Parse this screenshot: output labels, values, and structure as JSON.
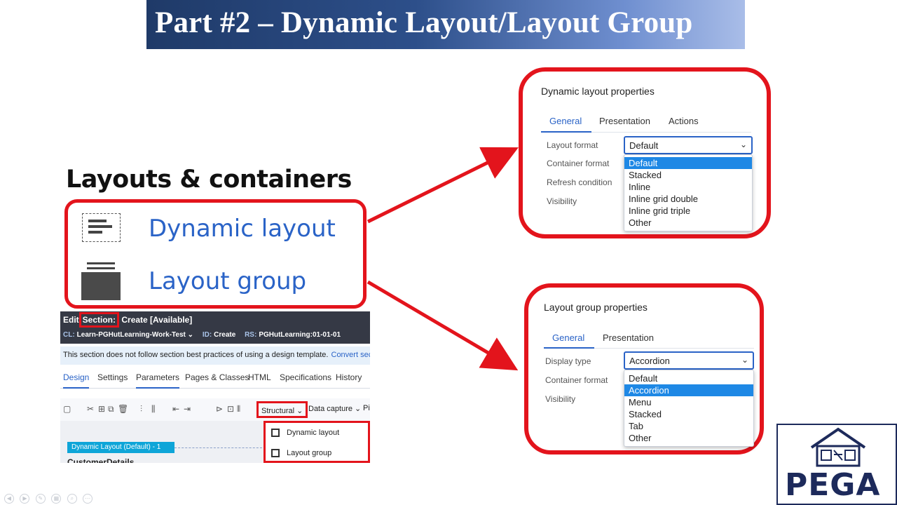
{
  "title": "Part #2 – Dynamic Layout/Layout Group",
  "layouts": {
    "heading": "Layouts & containers",
    "items": [
      {
        "label": "Dynamic layout",
        "icon": "dynamic-layout-icon"
      },
      {
        "label": "Layout group",
        "icon": "layout-group-icon"
      }
    ]
  },
  "editor": {
    "title_prefix": "Edit",
    "section_label": "Section:",
    "title_rest": "Create [Available]",
    "meta": {
      "cl_key": "CL:",
      "cl_value": "Learn-PGHutLearning-Work-Test ⌄",
      "id_key": "ID:",
      "id_value": "Create",
      "rs_key": "RS:",
      "rs_value": "PGHutLearning:01-01-01"
    },
    "notice": "This section does not follow section best practices of using a design template.",
    "notice_link": "Convert section to use",
    "tabs": [
      "Design",
      "Settings",
      "Parameters",
      "Pages & Classes",
      "HTML",
      "Specifications",
      "History"
    ],
    "toolbar": {
      "structural_label": "Structural ⌄",
      "data_capture_label": "Data capture ⌄",
      "more_label": "Pi"
    },
    "canvas": {
      "chip_label": "Dynamic Layout (Default) -   1",
      "section_label": "CustomerDetails"
    },
    "structural_menu": [
      "Dynamic layout",
      "Layout group"
    ]
  },
  "dynamic_panel": {
    "title": "Dynamic layout properties",
    "tabs": [
      "General",
      "Presentation",
      "Actions"
    ],
    "active_tab": "General",
    "fields": [
      "Layout format",
      "Container format",
      "Refresh condition",
      "Visibility"
    ],
    "select_value": "Default",
    "options": [
      "Default",
      "Stacked",
      "Inline",
      "Inline grid double",
      "Inline grid triple",
      "Other"
    ],
    "selected_option": "Default"
  },
  "group_panel": {
    "title": "Layout group properties",
    "tabs": [
      "General",
      "Presentation"
    ],
    "active_tab": "General",
    "fields": [
      "Display type",
      "Container format",
      "Visibility"
    ],
    "select_value": "Accordion",
    "options": [
      "Default",
      "Accordion",
      "Menu",
      "Stacked",
      "Tab",
      "Other"
    ],
    "selected_option": "Accordion"
  },
  "logo": {
    "text": "PEGA"
  },
  "colors": {
    "accent_red": "#e3141c",
    "link_blue": "#2a63c7",
    "banner_dark": "#1f3a68",
    "logo_navy": "#1d2a5b"
  }
}
